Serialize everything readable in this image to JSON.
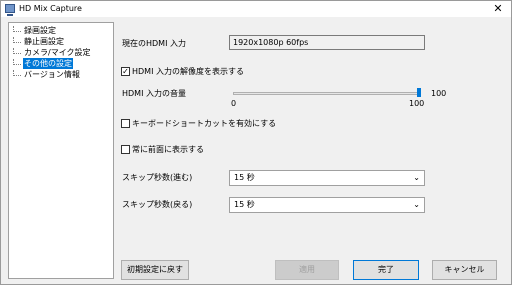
{
  "window": {
    "title": "HD Mix Capture"
  },
  "tree": {
    "items": [
      {
        "label": "録画設定"
      },
      {
        "label": "静止画設定"
      },
      {
        "label": "カメラ/マイク設定"
      },
      {
        "label": "その他の設定",
        "selected": true
      },
      {
        "label": "バージョン情報"
      }
    ]
  },
  "settings": {
    "hdmi_input_label": "現在のHDMI 入力",
    "hdmi_input_value": "1920x1080p 60fps",
    "show_resolution_label": "HDMI 入力の解像度を表示する",
    "show_resolution_checked": true,
    "volume_label": "HDMI 入力の音量",
    "volume_min": "0",
    "volume_max": "100",
    "volume_value": "100",
    "volume_level": 100,
    "shortcut_label": "キーボードショートカットを有効にする",
    "shortcut_checked": false,
    "always_on_top_label": "常に前面に表示する",
    "always_on_top_checked": false,
    "skip_forward_label": "スキップ秒数(進む)",
    "skip_forward_value": "15 秒",
    "skip_back_label": "スキップ秒数(戻る)",
    "skip_back_value": "15 秒"
  },
  "buttons": {
    "reset": "初期設定に戻す",
    "apply": "適用",
    "ok": "完了",
    "cancel": "キャンセル"
  }
}
